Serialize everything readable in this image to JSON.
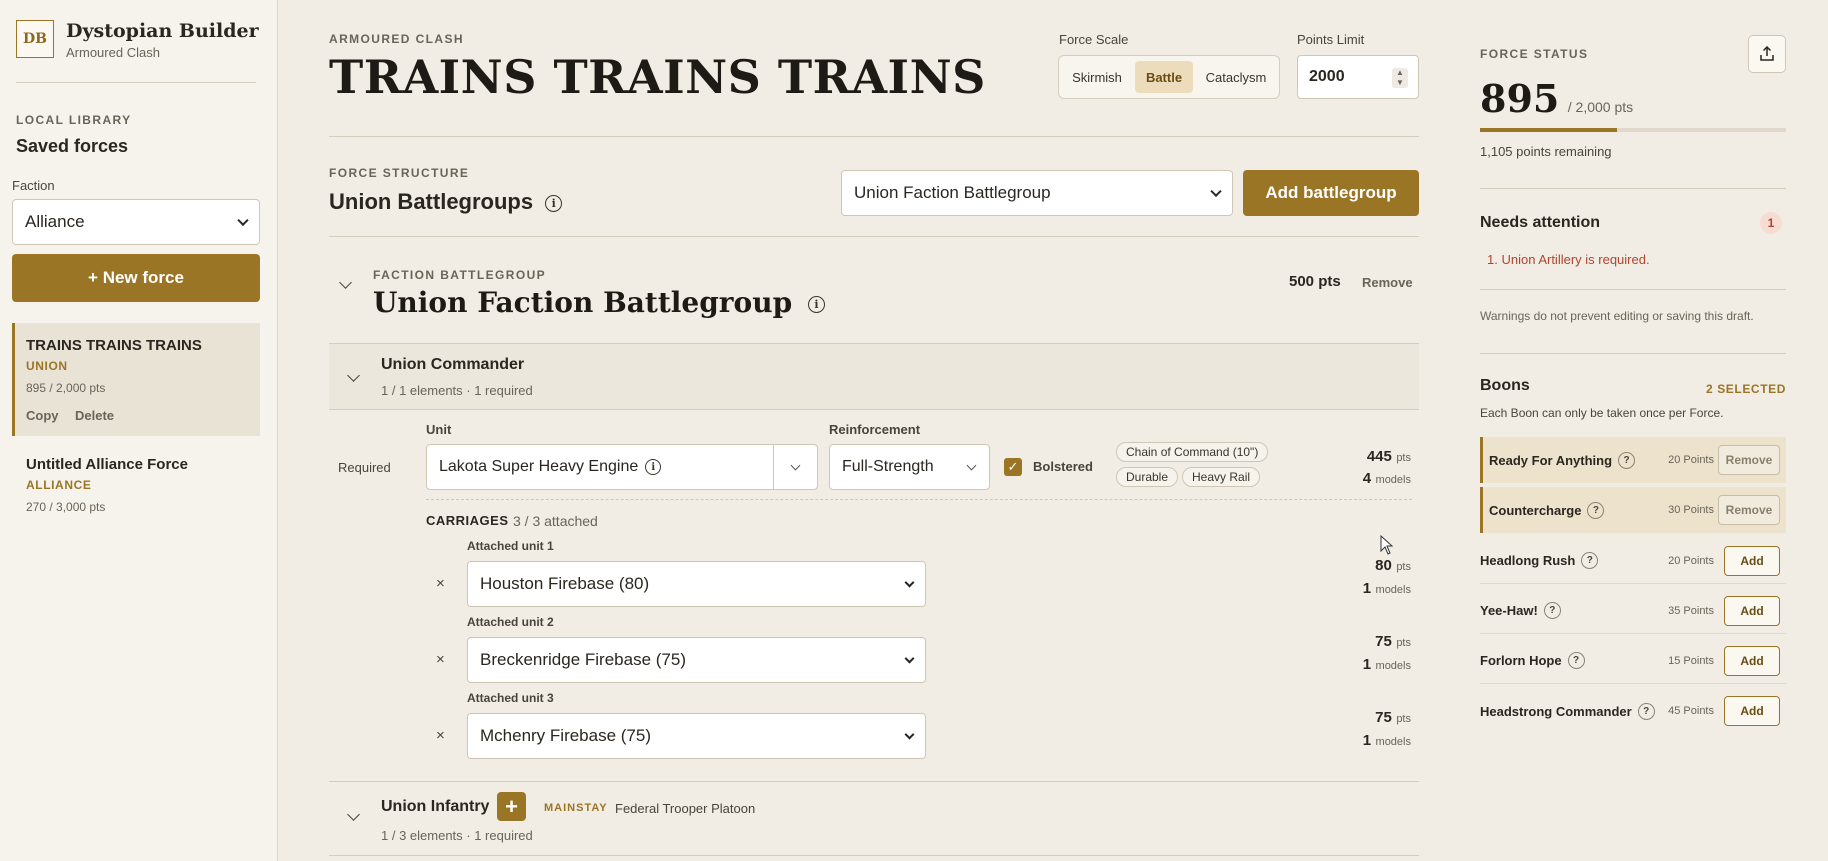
{
  "app": {
    "logo": "DB",
    "title": "Dystopian Builder",
    "subtitle": "Armoured Clash"
  },
  "sidebar": {
    "library_label": "LOCAL LIBRARY",
    "saved_title": "Saved forces",
    "faction_label": "Faction",
    "faction_value": "Alliance",
    "new_force_label": "+ New force",
    "forces": [
      {
        "name": "TRAINS TRAINS TRAINS",
        "faction": "UNION",
        "points": "895 / 2,000 pts",
        "copy": "Copy",
        "delete": "Delete"
      },
      {
        "name": "Untitled Alliance Force",
        "faction": "ALLIANCE",
        "points": "270 / 3,000 pts"
      }
    ]
  },
  "header": {
    "eyebrow": "ARMOURED CLASH",
    "title": "TRAINS TRAINS TRAINS",
    "scale_label": "Force Scale",
    "scale_options": [
      "Skirmish",
      "Battle",
      "Cataclysm"
    ],
    "scale_selected": "Battle",
    "points_label": "Points Limit",
    "points_value": "2000"
  },
  "structure": {
    "eyebrow": "FORCE STRUCTURE",
    "title": "Union Battlegroups",
    "select_value": "Union Faction Battlegroup",
    "add_label": "Add battlegroup"
  },
  "battlegroup": {
    "eyebrow": "FACTION BATTLEGROUP",
    "title": "Union Faction Battlegroup",
    "points": "500 pts",
    "remove": "Remove",
    "commander": {
      "title": "Union Commander",
      "meta": "1 / 1 elements · 1 required",
      "required_label": "Required",
      "unit_label": "Unit",
      "unit_value": "Lakota Super Heavy Engine",
      "reinf_label": "Reinforcement",
      "reinf_value": "Full-Strength",
      "bolstered_label": "Bolstered",
      "tags": [
        "Chain of Command (10\")",
        "Durable",
        "Heavy Rail"
      ],
      "pts": "445",
      "pts_unit": "pts",
      "models": "4",
      "models_unit": "models",
      "carriages_label": "CARRIAGES",
      "carriages_meta": "3 / 3 attached",
      "attached": [
        {
          "label": "Attached unit 1",
          "value": "Houston Firebase (80)",
          "pts": "80",
          "models": "1"
        },
        {
          "label": "Attached unit 2",
          "value": "Breckenridge Firebase (75)",
          "pts": "75",
          "models": "1"
        },
        {
          "label": "Attached unit 3",
          "value": "Mchenry Firebase (75)",
          "pts": "75",
          "models": "1"
        }
      ]
    },
    "infantry": {
      "title": "Union Infantry",
      "badge": "MAINSTAY",
      "unit": "Federal Trooper Platoon",
      "meta": "1 / 3 elements · 1 required"
    }
  },
  "status": {
    "label": "FORCE STATUS",
    "points": "895",
    "limit": "/ 2,000 pts",
    "progress": 0.4475,
    "remaining": "1,105 points remaining",
    "attention_title": "Needs attention",
    "attention_count": "1",
    "attention_item": "1. Union Artillery is required.",
    "warning_note": "Warnings do not prevent editing or saving this draft."
  },
  "boons": {
    "title": "Boons",
    "selected": "2 SELECTED",
    "note": "Each Boon can only be taken once per Force.",
    "items": [
      {
        "name": "Ready For Anything",
        "points": "20 Points",
        "action": "Remove"
      },
      {
        "name": "Countercharge",
        "points": "30 Points",
        "action": "Remove"
      },
      {
        "name": "Headlong Rush",
        "points": "20 Points",
        "action": "Add"
      },
      {
        "name": "Yee-Haw!",
        "points": "35 Points",
        "action": "Add"
      },
      {
        "name": "Forlorn Hope",
        "points": "15 Points",
        "action": "Add"
      },
      {
        "name": "Headstrong Commander",
        "points": "45 Points",
        "action": "Add"
      }
    ]
  },
  "colors": {
    "accent": "#9b7526",
    "background": "#f1ede4",
    "error": "#b0452e"
  }
}
